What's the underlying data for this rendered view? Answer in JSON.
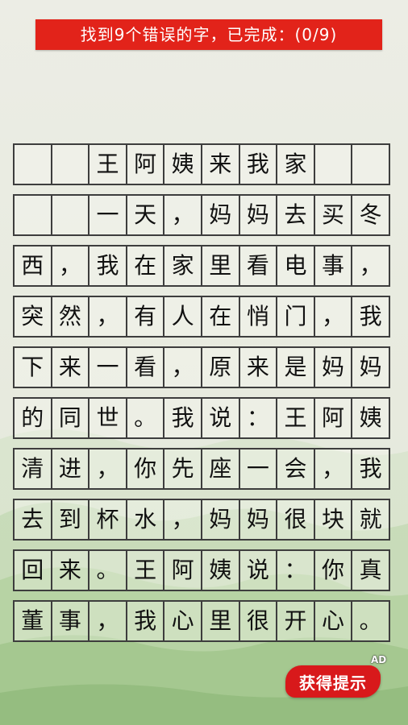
{
  "status_banner": {
    "text": "找到9个错误的字，已完成：(0/9)"
  },
  "grid": {
    "rows": [
      [
        "",
        "",
        "王",
        "阿",
        "姨",
        "来",
        "我",
        "家",
        "",
        ""
      ],
      [
        "",
        "",
        "一",
        "天",
        "，",
        "妈",
        "妈",
        "去",
        "买",
        "冬"
      ],
      [
        "西",
        "，",
        "我",
        "在",
        "家",
        "里",
        "看",
        "电",
        "事",
        "，"
      ],
      [
        "突",
        "然",
        "，",
        "有",
        "人",
        "在",
        "悄",
        "门",
        "，",
        "我"
      ],
      [
        "下",
        "来",
        "一",
        "看",
        "，",
        "原",
        "来",
        "是",
        "妈",
        "妈"
      ],
      [
        "的",
        "同",
        "世",
        "。",
        "我",
        "说",
        "：",
        "王",
        "阿",
        "姨"
      ],
      [
        "清",
        "进",
        "，",
        "你",
        "先",
        "座",
        "一",
        "会",
        "，",
        "我"
      ],
      [
        "去",
        "到",
        "杯",
        "水",
        "，",
        "妈",
        "妈",
        "很",
        "块",
        "就"
      ],
      [
        "回",
        "来",
        "。",
        "王",
        "阿",
        "姨",
        "说",
        "：",
        "你",
        "真"
      ],
      [
        "董",
        "事",
        "，",
        "我",
        "心",
        "里",
        "很",
        "开",
        "心",
        "。"
      ]
    ]
  },
  "hint_button": {
    "label": "获得提示",
    "badge": "AD"
  },
  "colors": {
    "banner": "#e2231a",
    "hint_button": "#d8191b",
    "grid_line": "#3d3d3d"
  }
}
